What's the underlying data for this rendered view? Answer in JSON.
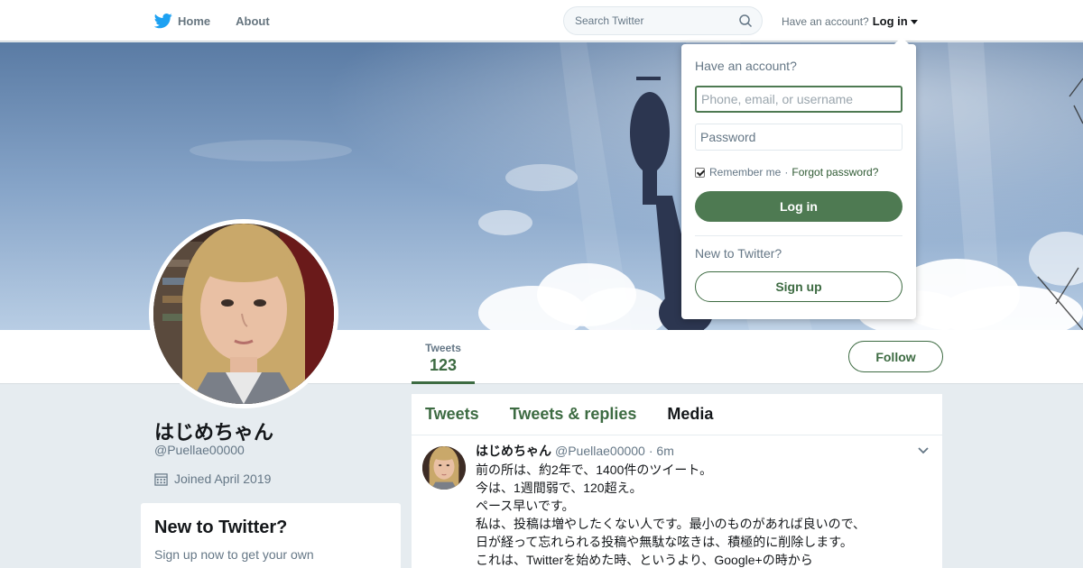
{
  "nav": {
    "home_label": "Home",
    "about_label": "About",
    "search_placeholder": "Search Twitter",
    "account_prompt": "Have an account?",
    "login_label": "Log in"
  },
  "profile": {
    "name": "はじめちゃん",
    "handle": "@Puellae00000",
    "joined": "Joined April 2019",
    "tweets_label": "Tweets",
    "tweets_count": "123",
    "follow_label": "Follow"
  },
  "signup_card": {
    "title": "New to Twitter?",
    "text": "Sign up now to get your own personalized timeline!"
  },
  "timeline": {
    "tabs": [
      {
        "label": "Tweets"
      },
      {
        "label": "Tweets & replies"
      },
      {
        "label": "Media"
      }
    ],
    "tweet": {
      "name": "はじめちゃん",
      "handle": "@Puellae00000",
      "time": "· 6m",
      "lines": [
        "前の所は、約2年で、1400件のツイート。",
        "今は、1週間弱で、120超え。",
        "ペース早いです。",
        "私は、投稿は増やしたくない人です。最小のものがあれば良いので、",
        "日が経って忘れられる投稿や無駄な呟きは、積極的に削除します。",
        "これは、Twitterを始めた時、というより、Google+の時から"
      ]
    }
  },
  "login_dropdown": {
    "title": "Have an account?",
    "username_placeholder": "Phone, email, or username",
    "password_placeholder": "Password",
    "remember_label": "Remember me",
    "separator": "·",
    "forgot_label": "Forgot password?",
    "login_button": "Log in",
    "new_prompt": "New to Twitter?",
    "signup_button": "Sign up"
  },
  "colors": {
    "accent": "#3d6b42",
    "login_button": "#4e7a52",
    "twitter_blue": "#1da1f2"
  }
}
